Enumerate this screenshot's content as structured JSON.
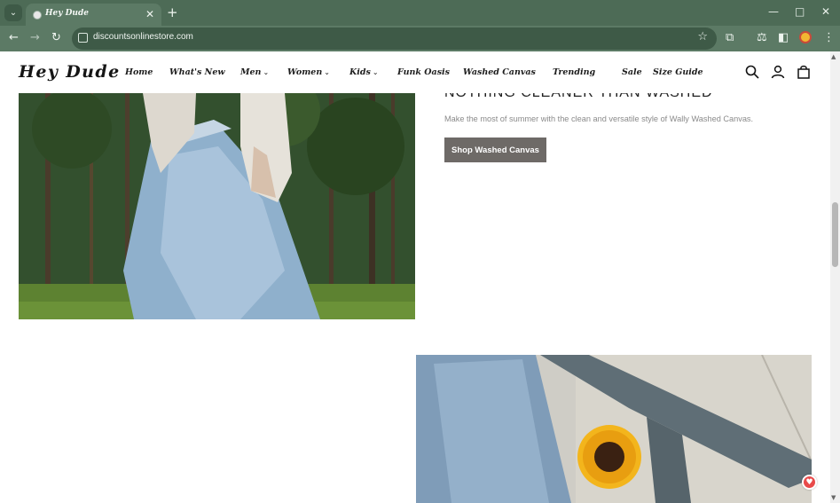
{
  "browser": {
    "tab_title": "Hey Dude",
    "url": "discountsonlinestore.com"
  },
  "site": {
    "logo": "Hey Dude",
    "nav": [
      {
        "label": "Home",
        "dropdown": false
      },
      {
        "label": "What's New",
        "dropdown": false
      },
      {
        "label": "Men",
        "dropdown": true
      },
      {
        "label": "Women",
        "dropdown": true
      },
      {
        "label": "Kids",
        "dropdown": true
      },
      {
        "label": "Funk Oasis",
        "dropdown": false
      },
      {
        "label": "Washed Canvas",
        "dropdown": false
      },
      {
        "label": "Trending",
        "dropdown": false
      },
      {
        "label": "Sale",
        "dropdown": false
      },
      {
        "label": "Size Guide",
        "dropdown": false
      }
    ]
  },
  "promo": {
    "title": "NOTHING CLEANER THAN WASHED",
    "subtitle": "Make the most of summer with the clean and versatile style of Wally Washed Canvas.",
    "button": "Shop Washed Canvas"
  },
  "colors": {
    "chrome": "#4d6b56",
    "button": "#6e6a67",
    "chat": "#e84a4a"
  },
  "icons": [
    "search-icon",
    "account-icon",
    "cart-icon",
    "chat-icon"
  ]
}
